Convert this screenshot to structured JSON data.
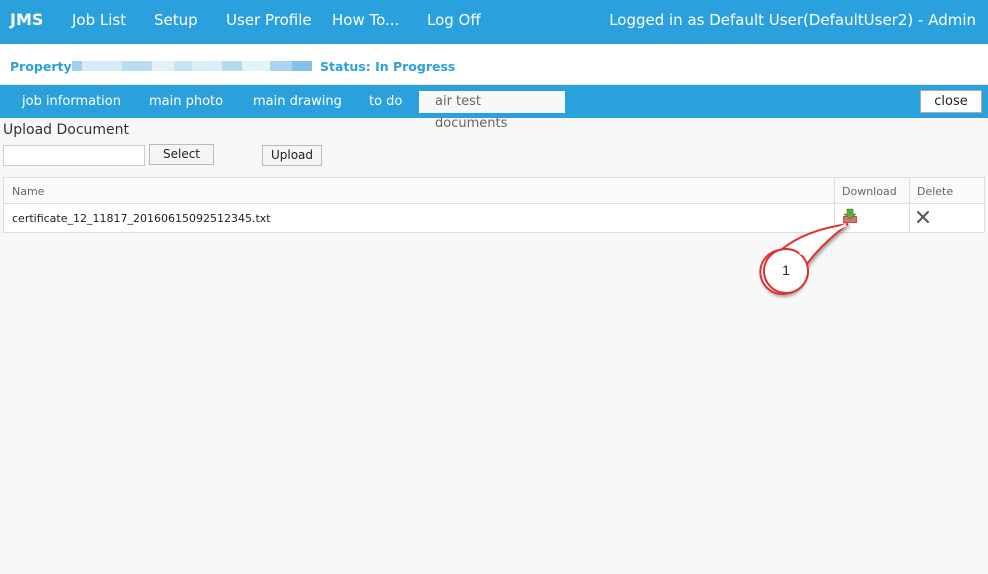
{
  "topbar": {
    "brand": "JMS",
    "nav": [
      "Job List",
      "Setup",
      "User Profile",
      "How To...",
      "Log Off"
    ],
    "login_text": "Logged in as Default User(DefaultUser2) - Admin"
  },
  "property": {
    "label": "Property:",
    "status": "Status: In Progress"
  },
  "tabs": [
    "job information",
    "main photo",
    "main drawing",
    "to do",
    "air test documents"
  ],
  "close_label": "close",
  "upload": {
    "title": "Upload Document",
    "select_label": "Select",
    "upload_label": "Upload"
  },
  "table": {
    "headers": [
      "Name",
      "Download",
      "Delete"
    ],
    "rows": [
      {
        "name": "certificate_12_11817_20160615092512345.txt"
      }
    ]
  },
  "annotation": {
    "number": "1"
  },
  "colors": {
    "accent": "#2aa1dc",
    "callout": "#e03030"
  }
}
